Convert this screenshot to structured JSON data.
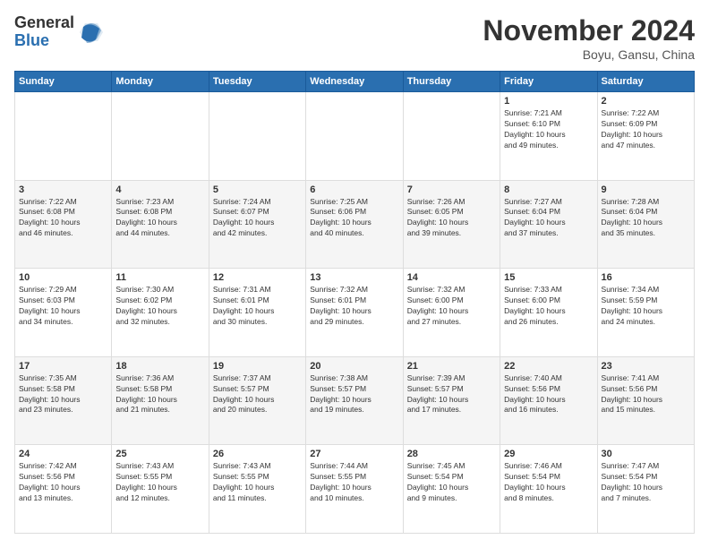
{
  "header": {
    "logo_general": "General",
    "logo_blue": "Blue",
    "month_title": "November 2024",
    "location": "Boyu, Gansu, China"
  },
  "weekdays": [
    "Sunday",
    "Monday",
    "Tuesday",
    "Wednesday",
    "Thursday",
    "Friday",
    "Saturday"
  ],
  "weeks": [
    [
      {
        "day": "",
        "info": ""
      },
      {
        "day": "",
        "info": ""
      },
      {
        "day": "",
        "info": ""
      },
      {
        "day": "",
        "info": ""
      },
      {
        "day": "",
        "info": ""
      },
      {
        "day": "1",
        "info": "Sunrise: 7:21 AM\nSunset: 6:10 PM\nDaylight: 10 hours\nand 49 minutes."
      },
      {
        "day": "2",
        "info": "Sunrise: 7:22 AM\nSunset: 6:09 PM\nDaylight: 10 hours\nand 47 minutes."
      }
    ],
    [
      {
        "day": "3",
        "info": "Sunrise: 7:22 AM\nSunset: 6:08 PM\nDaylight: 10 hours\nand 46 minutes."
      },
      {
        "day": "4",
        "info": "Sunrise: 7:23 AM\nSunset: 6:08 PM\nDaylight: 10 hours\nand 44 minutes."
      },
      {
        "day": "5",
        "info": "Sunrise: 7:24 AM\nSunset: 6:07 PM\nDaylight: 10 hours\nand 42 minutes."
      },
      {
        "day": "6",
        "info": "Sunrise: 7:25 AM\nSunset: 6:06 PM\nDaylight: 10 hours\nand 40 minutes."
      },
      {
        "day": "7",
        "info": "Sunrise: 7:26 AM\nSunset: 6:05 PM\nDaylight: 10 hours\nand 39 minutes."
      },
      {
        "day": "8",
        "info": "Sunrise: 7:27 AM\nSunset: 6:04 PM\nDaylight: 10 hours\nand 37 minutes."
      },
      {
        "day": "9",
        "info": "Sunrise: 7:28 AM\nSunset: 6:04 PM\nDaylight: 10 hours\nand 35 minutes."
      }
    ],
    [
      {
        "day": "10",
        "info": "Sunrise: 7:29 AM\nSunset: 6:03 PM\nDaylight: 10 hours\nand 34 minutes."
      },
      {
        "day": "11",
        "info": "Sunrise: 7:30 AM\nSunset: 6:02 PM\nDaylight: 10 hours\nand 32 minutes."
      },
      {
        "day": "12",
        "info": "Sunrise: 7:31 AM\nSunset: 6:01 PM\nDaylight: 10 hours\nand 30 minutes."
      },
      {
        "day": "13",
        "info": "Sunrise: 7:32 AM\nSunset: 6:01 PM\nDaylight: 10 hours\nand 29 minutes."
      },
      {
        "day": "14",
        "info": "Sunrise: 7:32 AM\nSunset: 6:00 PM\nDaylight: 10 hours\nand 27 minutes."
      },
      {
        "day": "15",
        "info": "Sunrise: 7:33 AM\nSunset: 6:00 PM\nDaylight: 10 hours\nand 26 minutes."
      },
      {
        "day": "16",
        "info": "Sunrise: 7:34 AM\nSunset: 5:59 PM\nDaylight: 10 hours\nand 24 minutes."
      }
    ],
    [
      {
        "day": "17",
        "info": "Sunrise: 7:35 AM\nSunset: 5:58 PM\nDaylight: 10 hours\nand 23 minutes."
      },
      {
        "day": "18",
        "info": "Sunrise: 7:36 AM\nSunset: 5:58 PM\nDaylight: 10 hours\nand 21 minutes."
      },
      {
        "day": "19",
        "info": "Sunrise: 7:37 AM\nSunset: 5:57 PM\nDaylight: 10 hours\nand 20 minutes."
      },
      {
        "day": "20",
        "info": "Sunrise: 7:38 AM\nSunset: 5:57 PM\nDaylight: 10 hours\nand 19 minutes."
      },
      {
        "day": "21",
        "info": "Sunrise: 7:39 AM\nSunset: 5:57 PM\nDaylight: 10 hours\nand 17 minutes."
      },
      {
        "day": "22",
        "info": "Sunrise: 7:40 AM\nSunset: 5:56 PM\nDaylight: 10 hours\nand 16 minutes."
      },
      {
        "day": "23",
        "info": "Sunrise: 7:41 AM\nSunset: 5:56 PM\nDaylight: 10 hours\nand 15 minutes."
      }
    ],
    [
      {
        "day": "24",
        "info": "Sunrise: 7:42 AM\nSunset: 5:56 PM\nDaylight: 10 hours\nand 13 minutes."
      },
      {
        "day": "25",
        "info": "Sunrise: 7:43 AM\nSunset: 5:55 PM\nDaylight: 10 hours\nand 12 minutes."
      },
      {
        "day": "26",
        "info": "Sunrise: 7:43 AM\nSunset: 5:55 PM\nDaylight: 10 hours\nand 11 minutes."
      },
      {
        "day": "27",
        "info": "Sunrise: 7:44 AM\nSunset: 5:55 PM\nDaylight: 10 hours\nand 10 minutes."
      },
      {
        "day": "28",
        "info": "Sunrise: 7:45 AM\nSunset: 5:54 PM\nDaylight: 10 hours\nand 9 minutes."
      },
      {
        "day": "29",
        "info": "Sunrise: 7:46 AM\nSunset: 5:54 PM\nDaylight: 10 hours\nand 8 minutes."
      },
      {
        "day": "30",
        "info": "Sunrise: 7:47 AM\nSunset: 5:54 PM\nDaylight: 10 hours\nand 7 minutes."
      }
    ]
  ]
}
